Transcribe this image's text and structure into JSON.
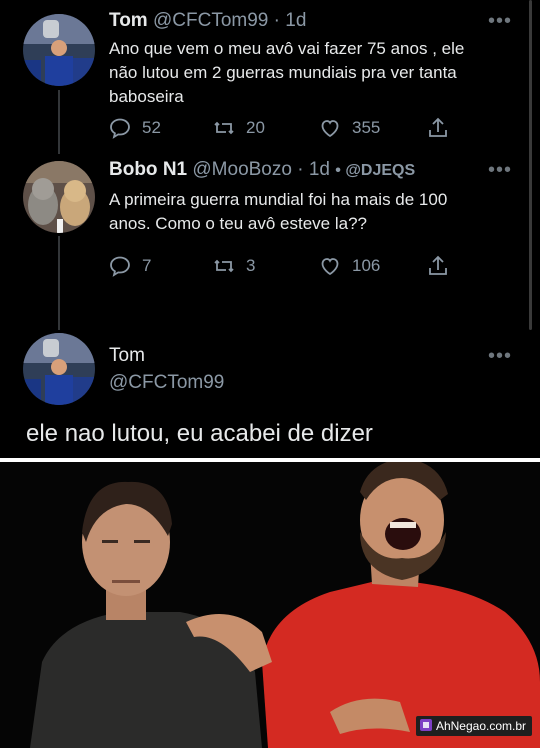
{
  "tweets": [
    {
      "name": "Tom",
      "handle": "@CFCTom99",
      "time": "· 1d",
      "text_lines": [
        "Ano que vem o meu avô vai fazer 75 anos , ele",
        "não lutou em 2 guerras mundiais pra ver tanta",
        "baboseira"
      ],
      "replies": "52",
      "retweets": "20",
      "likes": "355"
    },
    {
      "name": "Bobo N1",
      "handle": "@MooBozo",
      "time": "· 1d",
      "extra": "• @DJEQS",
      "text_lines": [
        "A primeira guerra mundial foi  ha mais de 100",
        "anos. Como o teu avô esteve la??"
      ],
      "replies": "7",
      "retweets": "3",
      "likes": "106"
    }
  ],
  "main_reply": {
    "name": "Tom",
    "handle": "@CFCTom99",
    "text": "ele nao lutou, eu acabei de dizer"
  },
  "watermark": "AhNegao.com.br",
  "icons": [
    "reply-icon",
    "retweet-icon",
    "like-icon",
    "share-icon",
    "more-icon"
  ],
  "colors": {
    "background": "#000000",
    "text": "#e7e9ea",
    "muted": "#8b98a5",
    "divider": "#ffffff",
    "sweater": "#d42a22"
  }
}
